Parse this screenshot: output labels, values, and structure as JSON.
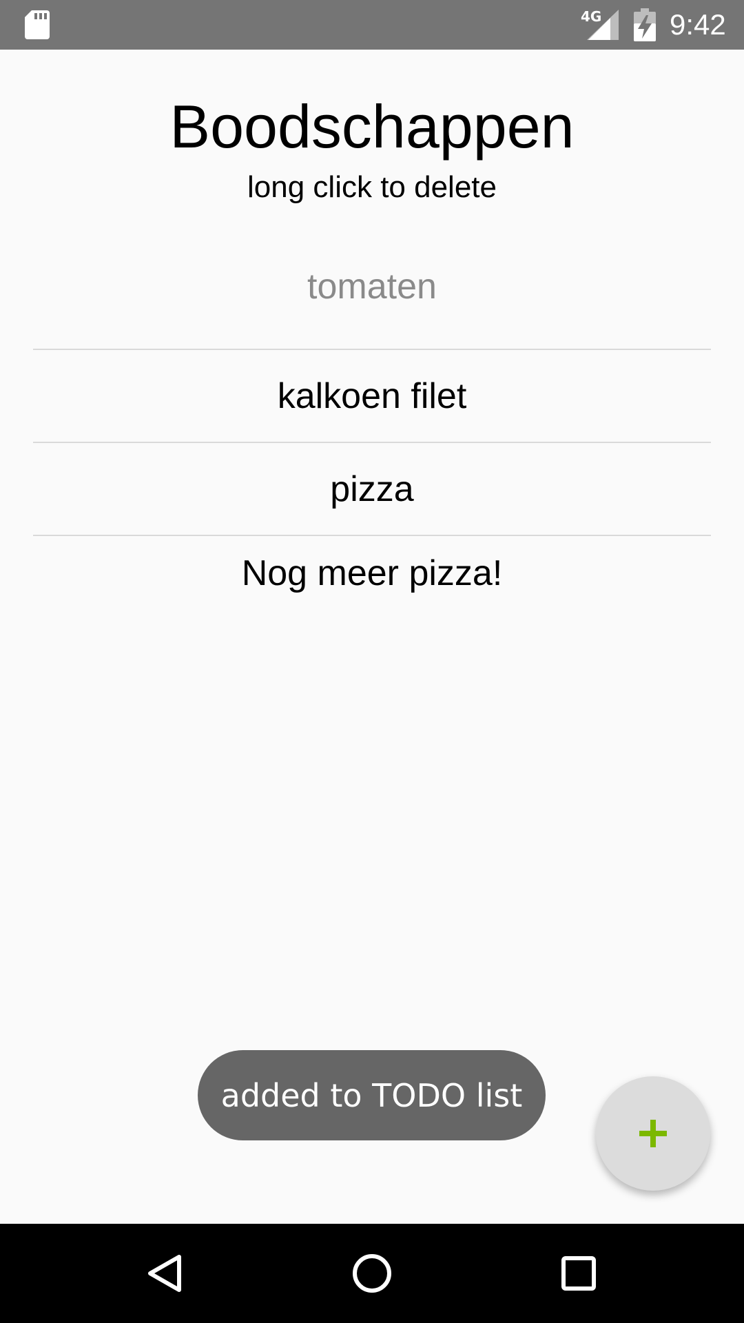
{
  "status_bar": {
    "network": "4G",
    "time": "9:42",
    "icons": [
      "sd-card-icon",
      "signal-icon",
      "battery-charging-icon"
    ]
  },
  "app": {
    "title": "Boodschappen",
    "subtitle": "long click to delete"
  },
  "list": {
    "items": [
      {
        "label": "tomaten"
      },
      {
        "label": "kalkoen filet"
      },
      {
        "label": "pizza"
      },
      {
        "label": "Nog meer pizza!"
      }
    ]
  },
  "toast": {
    "message": "added to TODO list"
  },
  "fab": {
    "icon": "plus-icon",
    "icon_color": "#7cb800"
  },
  "nav_bar": {
    "buttons": [
      "back-icon",
      "home-icon",
      "recents-icon"
    ]
  }
}
